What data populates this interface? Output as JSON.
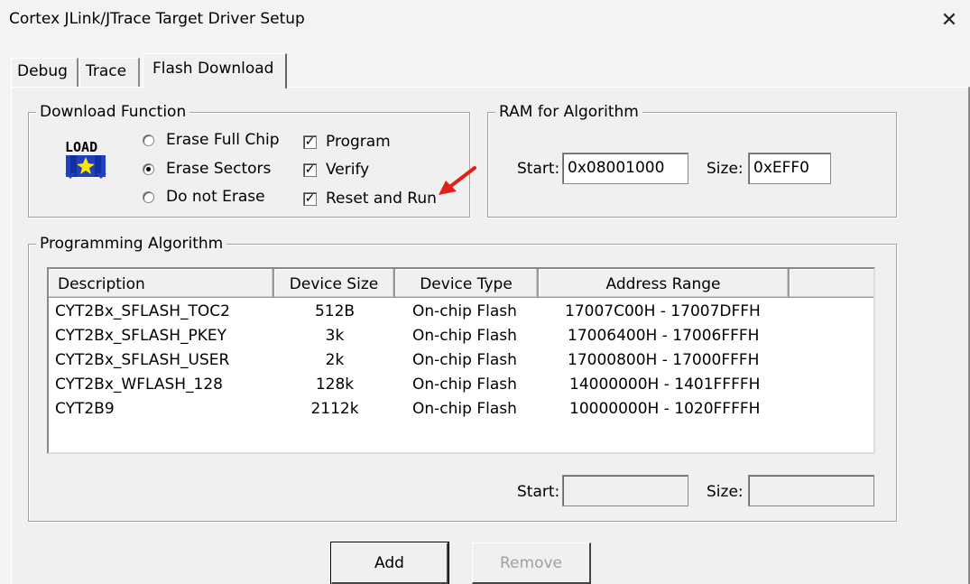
{
  "window": {
    "title": "Cortex JLink/JTrace Target Driver Setup",
    "close_glyph": "✕"
  },
  "tabs": [
    {
      "label": "Debug",
      "active": false
    },
    {
      "label": "Trace",
      "active": false
    },
    {
      "label": "Flash Download",
      "active": true
    }
  ],
  "download_function": {
    "legend": "Download Function",
    "icon": "load-icon",
    "radios": [
      {
        "label": "Erase Full Chip",
        "checked": false
      },
      {
        "label": "Erase Sectors",
        "checked": true
      },
      {
        "label": "Do not Erase",
        "checked": false
      }
    ],
    "checkboxes": [
      {
        "label": "Program",
        "checked": true
      },
      {
        "label": "Verify",
        "checked": true
      },
      {
        "label": "Reset and Run",
        "checked": true
      }
    ]
  },
  "ram_for_algorithm": {
    "legend": "RAM for Algorithm",
    "start_label": "Start:",
    "start_value": "0x08001000",
    "size_label": "Size:",
    "size_value": "0xEFF0"
  },
  "programming_algorithm": {
    "legend": "Programming Algorithm",
    "columns": [
      "Description",
      "Device Size",
      "Device Type",
      "Address Range"
    ],
    "rows": [
      [
        "CYT2Bx_SFLASH_TOC2",
        "512B",
        "On-chip Flash",
        "17007C00H - 17007DFFH"
      ],
      [
        "CYT2Bx_SFLASH_PKEY",
        "3k",
        "On-chip Flash",
        "17006400H - 17006FFFH"
      ],
      [
        "CYT2Bx_SFLASH_USER",
        "2k",
        "On-chip Flash",
        "17000800H - 17000FFFH"
      ],
      [
        "CYT2Bx_WFLASH_128",
        "128k",
        "On-chip Flash",
        "14000000H - 1401FFFFH"
      ],
      [
        "CYT2B9",
        "2112k",
        "On-chip Flash",
        "10000000H - 1020FFFFH"
      ]
    ],
    "start_label": "Start:",
    "start_value": "",
    "size_label": "Size:",
    "size_value": ""
  },
  "buttons": {
    "add": "Add",
    "remove": "Remove"
  },
  "colors": {
    "annotation_arrow": "#e0201a",
    "check_mark": "#000000"
  },
  "check_glyph": "✓"
}
